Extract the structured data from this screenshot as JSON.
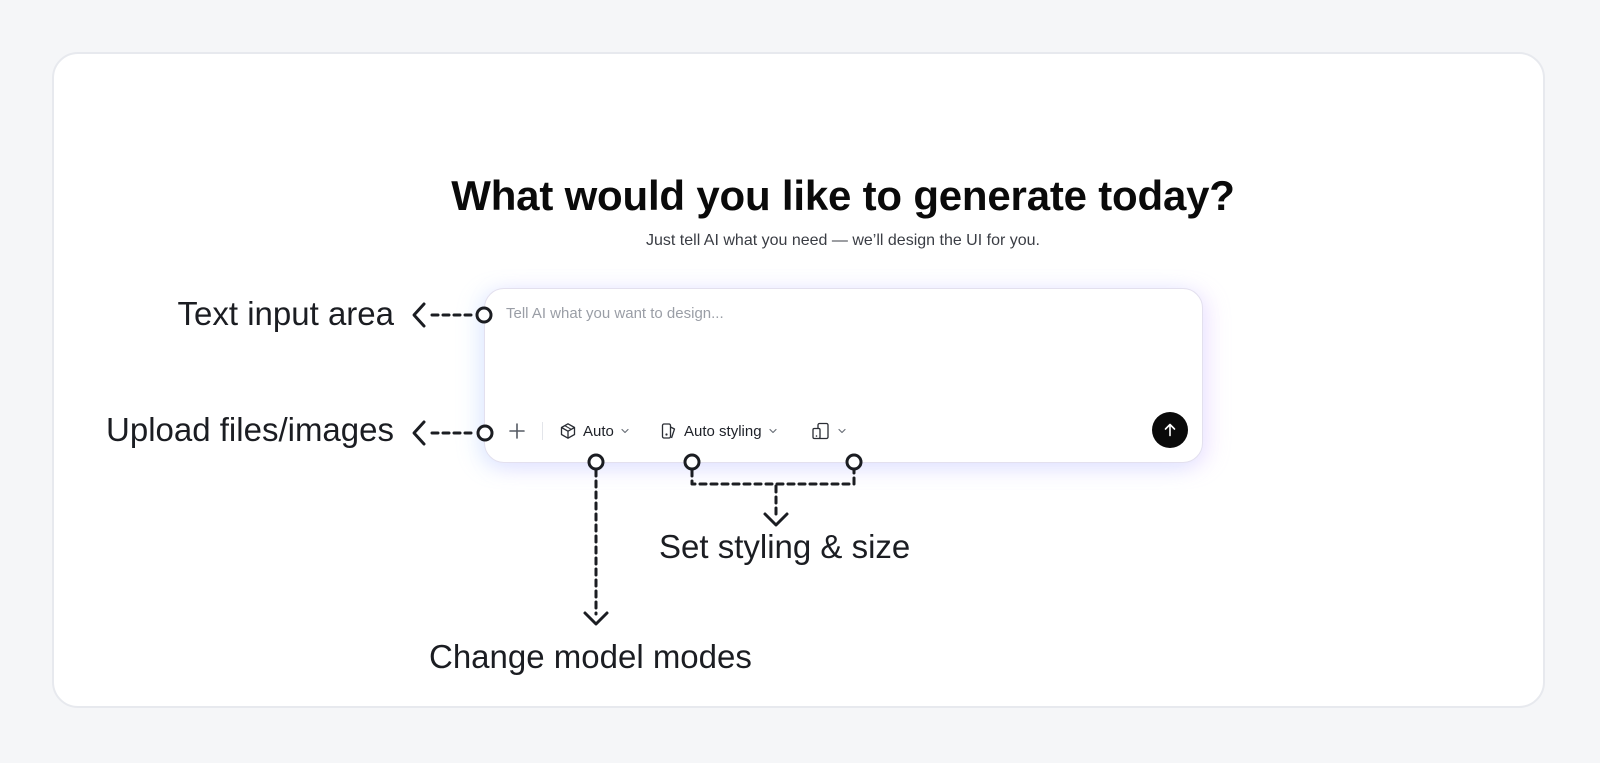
{
  "heading": {
    "title": "What would you like to generate today?",
    "subtitle": "Just tell AI what you need — we’ll design the UI for you."
  },
  "composer": {
    "placeholder": "Tell AI what you want to design...",
    "toolbar": {
      "upload_icon": "plus-icon",
      "model_icon": "cube-icon",
      "model_label": "Auto",
      "styling_icon": "paint-bucket-icon",
      "styling_label": "Auto styling",
      "size_icon": "device-size-icon",
      "chevron_icon": "chevron-down-icon",
      "send_icon": "arrow-up-icon"
    }
  },
  "annotations": {
    "text_input": "Text input area",
    "upload": "Upload files/images",
    "styling": "Set styling & size",
    "model": "Change model modes"
  },
  "colors": {
    "background": "#f5f6f8",
    "card": "#ffffff",
    "send_button": "#0a0a0a",
    "annotation": "#1b1d22"
  }
}
